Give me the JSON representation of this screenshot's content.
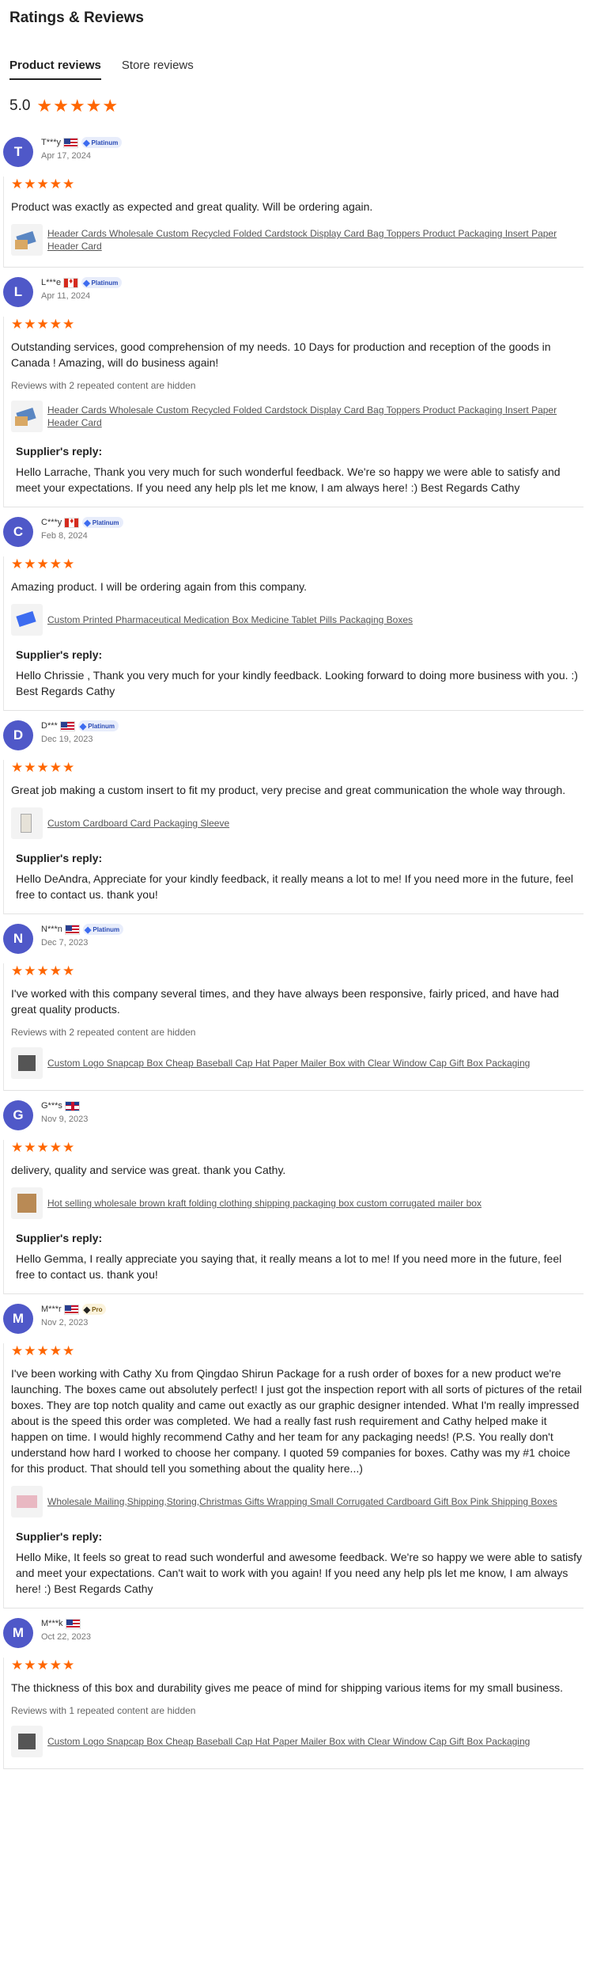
{
  "page": {
    "title": "Ratings & Reviews"
  },
  "tabs": [
    {
      "label": "Product reviews",
      "active": true
    },
    {
      "label": "Store reviews",
      "active": false
    }
  ],
  "summary": {
    "score": "5.0",
    "stars": 5
  },
  "colors": {
    "star": "#ff6600",
    "avatar": "#4f58c8",
    "badge": "#3d6cf0"
  },
  "reviews": [
    {
      "initial": "T",
      "name": "T***y",
      "flag": "us",
      "badge": "Platinum",
      "date": "Apr 17, 2024",
      "stars": 5,
      "text": "Product was exactly as expected and great quality. Will be ordering again.",
      "hidden_note": "",
      "product": "Header Cards Wholesale Custom Recycled Folded Cardstock Display Card Bag Toppers Product Packaging Insert Paper Header Card",
      "reply": ""
    },
    {
      "initial": "L",
      "name": "L***e",
      "flag": "ca",
      "badge": "Platinum",
      "date": "Apr 11, 2024",
      "stars": 5,
      "text": "Outstanding services, good comprehension of my needs. 10 Days for production and reception of the goods in Canada ! Amazing, will do business again!",
      "hidden_note": "Reviews with 2 repeated content are hidden",
      "product": "Header Cards Wholesale Custom Recycled Folded Cardstock Display Card Bag Toppers Product Packaging Insert Paper Header Card",
      "reply": "Hello Larrache, Thank you very much for such wonderful feedback. We're so happy we were able to satisfy and meet your expectations. If you need any help pls let me know, I am always here! :) Best Regards Cathy"
    },
    {
      "initial": "C",
      "name": "C***y",
      "flag": "ca",
      "badge": "Platinum",
      "date": "Feb 8, 2024",
      "stars": 5,
      "text": "Amazing product. I will be ordering again from this company.",
      "hidden_note": "",
      "product": "Custom Printed Pharmaceutical Medication Box Medicine Tablet Pills Packaging Boxes",
      "reply": "Hello Chrissie , Thank you very much for your kindly feedback. Looking forward to doing more business with you. :) Best Regards Cathy"
    },
    {
      "initial": "D",
      "name": "D***",
      "flag": "us",
      "badge": "Platinum",
      "date": "Dec 19, 2023",
      "stars": 5,
      "text": "Great job making a custom insert to fit my product, very precise and great communication the whole way through.",
      "hidden_note": "",
      "product": "Custom Cardboard Card Packaging Sleeve",
      "reply": "Hello DeAndra, Appreciate for your kindly feedback, it really means a lot to me! If you need more in the future, feel free to contact us. thank you!"
    },
    {
      "initial": "N",
      "name": "N***n",
      "flag": "us",
      "badge": "Platinum",
      "date": "Dec 7, 2023",
      "stars": 5,
      "text": "I've worked with this company several times, and they have always been responsive, fairly priced, and have had great quality products.",
      "hidden_note": "Reviews with 2 repeated content are hidden",
      "product": "Custom Logo Snapcap Box Cheap Baseball Cap Hat Paper Mailer Box with Clear Window Cap Gift Box Packaging",
      "reply": ""
    },
    {
      "initial": "G",
      "name": "G***s",
      "flag": "uk",
      "badge": "",
      "date": "Nov 9, 2023",
      "stars": 5,
      "text": "delivery, quality and service was great. thank you Cathy.",
      "hidden_note": "",
      "product": "Hot selling wholesale brown kraft folding clothing shipping packaging box custom corrugated mailer box",
      "reply": "Hello Gemma, I really appreciate you saying that, it really means a lot to me! If you need more in the future, feel free to contact us. thank you!"
    },
    {
      "initial": "M",
      "name": "M***r",
      "flag": "us",
      "badge": "Pro",
      "date": "Nov 2, 2023",
      "stars": 5,
      "text": "I've been working with Cathy Xu from Qingdao Shirun Package for a rush order of boxes for a new product we're launching. The boxes came out absolutely perfect! I just got the inspection report with all sorts of pictures of the retail boxes. They are top notch quality and came out exactly as our graphic designer intended. What I'm really impressed about is the speed this order was completed. We had a really fast rush requirement and Cathy helped make it happen on time. I would highly recommend Cathy and her team for any packaging needs! (P.S. You really don't understand how hard I worked to choose her company. I quoted 59 companies for boxes. Cathy was my #1 choice for this product. That should tell you something about the quality here...)",
      "hidden_note": "",
      "product": "Wholesale Mailing,Shipping,Storing,Christmas Gifts Wrapping Small Corrugated Cardboard Gift Box Pink Shipping Boxes",
      "reply": "Hello Mike, It feels so great to read such wonderful and awesome feedback. We're so happy we were able to satisfy and meet your expectations. Can't wait to work with you again! If you need any help pls let me know, I am always here! :) Best Regards Cathy"
    },
    {
      "initial": "M",
      "name": "M***k",
      "flag": "us",
      "badge": "",
      "date": "Oct 22, 2023",
      "stars": 5,
      "text": "The thickness of this box and durability gives me peace of mind for shipping various items for my small business.",
      "hidden_note": "Reviews with 1 repeated content are hidden",
      "product": "Custom Logo Snapcap Box Cheap Baseball Cap Hat Paper Mailer Box with Clear Window Cap Gift Box Packaging",
      "reply": ""
    }
  ],
  "labels": {
    "supplier_reply": "Supplier's reply:"
  }
}
